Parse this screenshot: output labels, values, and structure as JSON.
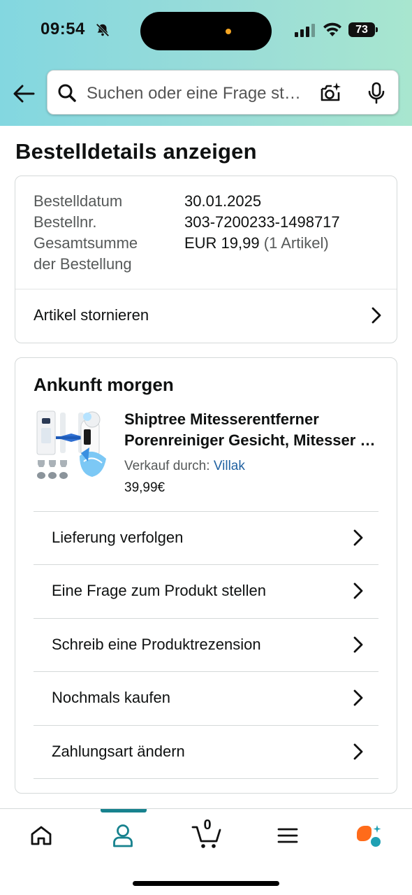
{
  "status_bar": {
    "time": "09:54",
    "battery": "73"
  },
  "search": {
    "placeholder": "Suchen oder eine Frage stellen"
  },
  "page": {
    "title": "Bestelldetails anzeigen"
  },
  "order": {
    "date_label": "Bestelldatum",
    "date_value": "30.01.2025",
    "number_label": "Bestellnr.",
    "number_value": "303-7200233-1498717",
    "total_label_line1": "Gesamtsumme",
    "total_label_line2": "der Bestellung",
    "total_value": "EUR 19,99",
    "total_items": "(1 Artikel)",
    "cancel_label": "Artikel stornieren"
  },
  "shipment": {
    "title": "Ankunft morgen",
    "product": {
      "name_line1": "Shiptree Mitesserentferner",
      "name_line2": "Porenreiniger Gesicht, Mitesser Entferner",
      "seller_prefix": "Verkauf durch:",
      "seller_name": "Villak",
      "price": "39,99€"
    },
    "actions": [
      {
        "label": "Lieferung verfolgen"
      },
      {
        "label": "Eine Frage zum Produkt stellen"
      },
      {
        "label": "Schreib eine Produktrezension"
      },
      {
        "label": "Nochmals kaufen"
      },
      {
        "label": "Zahlungsart ändern"
      }
    ]
  },
  "tabbar": {
    "cart_count": "0",
    "active_tab": "account"
  },
  "colors": {
    "header_gradient_start": "#83d7e0",
    "header_gradient_end": "#a8e6cf",
    "link": "#2162a1",
    "active_tab": "#17828e",
    "assistant_orange": "#ff6b1a",
    "assistant_teal": "#1fa0b3"
  }
}
